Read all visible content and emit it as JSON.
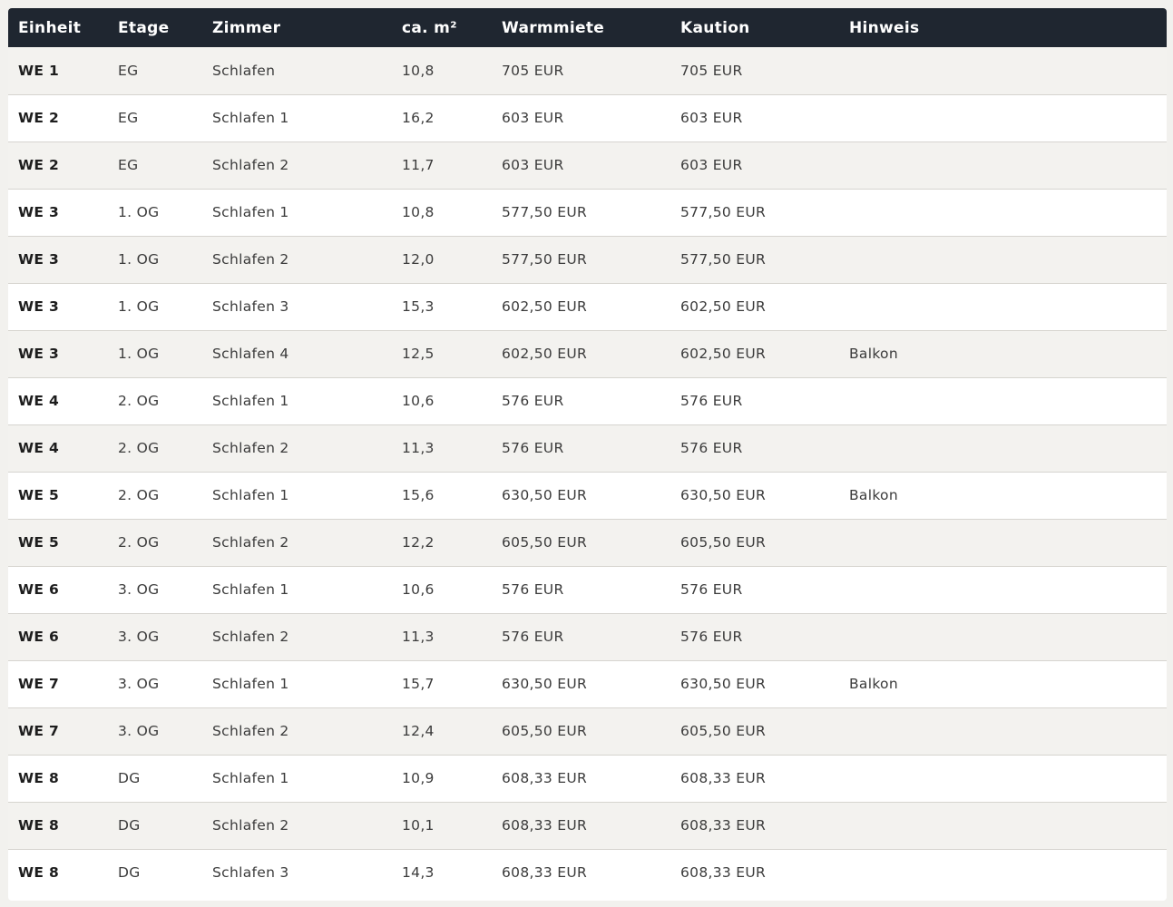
{
  "columns": [
    "Einheit",
    "Etage",
    "Zimmer",
    "ca. m²",
    "Warmmiete",
    "Kaution",
    "Hinweis"
  ],
  "rows": [
    {
      "einheit": "WE 1",
      "etage": "EG",
      "zimmer": "Schlafen",
      "m2": "10,8",
      "warmmiete": "705 EUR",
      "kaution": "705 EUR",
      "hinweis": ""
    },
    {
      "einheit": "WE 2",
      "etage": "EG",
      "zimmer": "Schlafen 1",
      "m2": "16,2",
      "warmmiete": "603 EUR",
      "kaution": "603 EUR",
      "hinweis": ""
    },
    {
      "einheit": "WE 2",
      "etage": "EG",
      "zimmer": "Schlafen 2",
      "m2": "11,7",
      "warmmiete": "603 EUR",
      "kaution": "603 EUR",
      "hinweis": ""
    },
    {
      "einheit": "WE 3",
      "etage": "1. OG",
      "zimmer": "Schlafen 1",
      "m2": "10,8",
      "warmmiete": "577,50 EUR",
      "kaution": "577,50 EUR",
      "hinweis": ""
    },
    {
      "einheit": "WE 3",
      "etage": "1. OG",
      "zimmer": "Schlafen 2",
      "m2": "12,0",
      "warmmiete": "577,50 EUR",
      "kaution": "577,50 EUR",
      "hinweis": ""
    },
    {
      "einheit": "WE 3",
      "etage": "1. OG",
      "zimmer": "Schlafen 3",
      "m2": "15,3",
      "warmmiete": "602,50 EUR",
      "kaution": "602,50 EUR",
      "hinweis": ""
    },
    {
      "einheit": "WE 3",
      "etage": "1. OG",
      "zimmer": "Schlafen 4",
      "m2": "12,5",
      "warmmiete": "602,50 EUR",
      "kaution": "602,50 EUR",
      "hinweis": "Balkon"
    },
    {
      "einheit": "WE 4",
      "etage": "2. OG",
      "zimmer": "Schlafen 1",
      "m2": "10,6",
      "warmmiete": "576 EUR",
      "kaution": "576 EUR",
      "hinweis": ""
    },
    {
      "einheit": "WE 4",
      "etage": "2. OG",
      "zimmer": "Schlafen 2",
      "m2": "11,3",
      "warmmiete": "576 EUR",
      "kaution": "576 EUR",
      "hinweis": ""
    },
    {
      "einheit": "WE 5",
      "etage": "2. OG",
      "zimmer": "Schlafen 1",
      "m2": "15,6",
      "warmmiete": "630,50 EUR",
      "kaution": "630,50 EUR",
      "hinweis": "Balkon"
    },
    {
      "einheit": "WE 5",
      "etage": "2. OG",
      "zimmer": "Schlafen 2",
      "m2": "12,2",
      "warmmiete": "605,50 EUR",
      "kaution": "605,50 EUR",
      "hinweis": ""
    },
    {
      "einheit": "WE 6",
      "etage": "3. OG",
      "zimmer": "Schlafen 1",
      "m2": "10,6",
      "warmmiete": "576 EUR",
      "kaution": "576 EUR",
      "hinweis": ""
    },
    {
      "einheit": "WE 6",
      "etage": "3. OG",
      "zimmer": "Schlafen 2",
      "m2": "11,3",
      "warmmiete": "576 EUR",
      "kaution": "576 EUR",
      "hinweis": ""
    },
    {
      "einheit": "WE 7",
      "etage": "3. OG",
      "zimmer": "Schlafen 1",
      "m2": "15,7",
      "warmmiete": "630,50 EUR",
      "kaution": "630,50 EUR",
      "hinweis": "Balkon"
    },
    {
      "einheit": "WE 7",
      "etage": "3. OG",
      "zimmer": "Schlafen 2",
      "m2": "12,4",
      "warmmiete": "605,50 EUR",
      "kaution": "605,50 EUR",
      "hinweis": ""
    },
    {
      "einheit": "WE 8",
      "etage": "DG",
      "zimmer": "Schlafen 1",
      "m2": "10,9",
      "warmmiete": "608,33 EUR",
      "kaution": "608,33 EUR",
      "hinweis": ""
    },
    {
      "einheit": "WE 8",
      "etage": "DG",
      "zimmer": "Schlafen 2",
      "m2": "10,1",
      "warmmiete": "608,33 EUR",
      "kaution": "608,33 EUR",
      "hinweis": ""
    },
    {
      "einheit": "WE 8",
      "etage": "DG",
      "zimmer": "Schlafen 3",
      "m2": "14,3",
      "warmmiete": "608,33 EUR",
      "kaution": "608,33 EUR",
      "hinweis": ""
    }
  ],
  "colors": {
    "header_bg": "#1f2630",
    "header_text": "#ffffff",
    "row_alt_bg": "#f3f2ef",
    "row_bg": "#ffffff",
    "page_bg": "#f2f1ee"
  }
}
